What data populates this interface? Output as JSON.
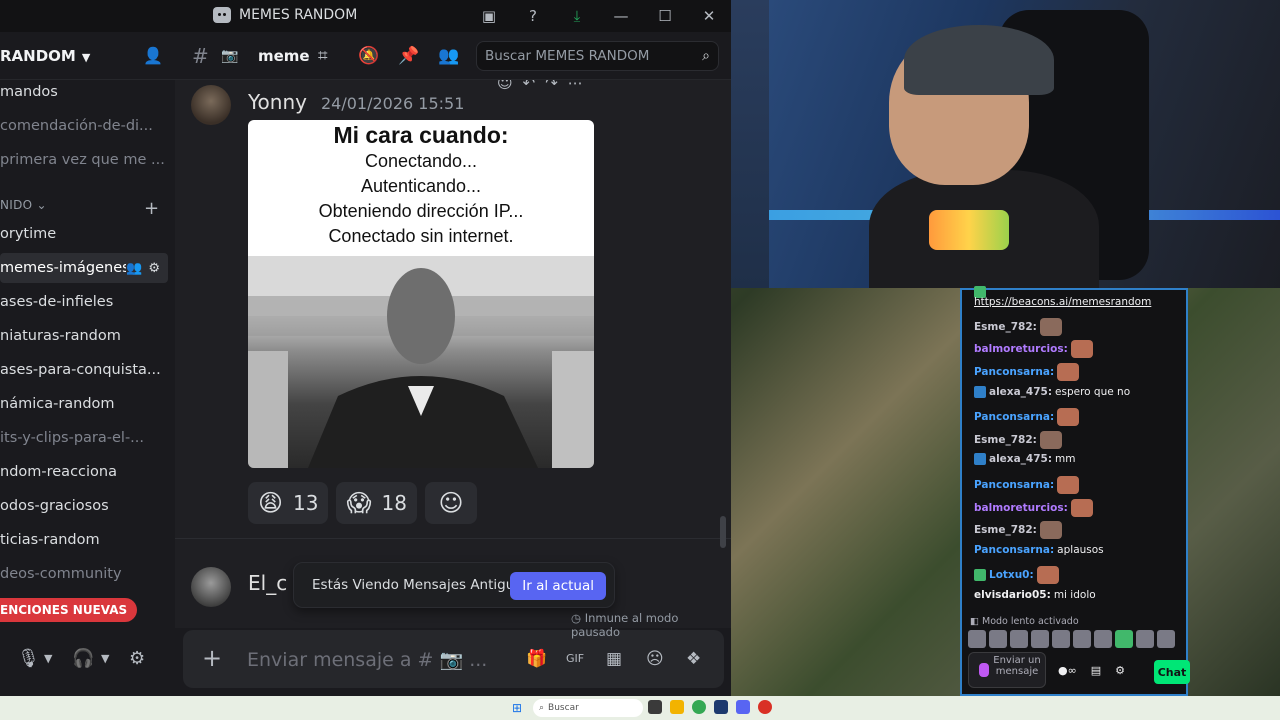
{
  "window": {
    "title": "MEMES RANDOM",
    "controls": [
      "minimize",
      "maximize",
      "close"
    ]
  },
  "sidebar": {
    "server_name": "RANDOM",
    "channels": [
      {
        "label": "mandos",
        "muted": false
      },
      {
        "label": "comendación-de-di...",
        "muted": true
      },
      {
        "label": "primera vez que me ...",
        "muted": true
      }
    ],
    "category": "NIDO",
    "category_channels": [
      {
        "label": "orytime",
        "muted": false
      },
      {
        "label": "memes-imágenes",
        "muted": false,
        "active": true
      },
      {
        "label": "ases-de-infieles",
        "muted": false
      },
      {
        "label": "niaturas-random",
        "muted": false
      },
      {
        "label": "ases-para-conquista...",
        "muted": false
      },
      {
        "label": "námica-random",
        "muted": false
      },
      {
        "label": "its-y-clips-para-el-...",
        "muted": true
      },
      {
        "label": "ndom-reacciona",
        "muted": false
      },
      {
        "label": "odos-graciosos",
        "muted": false
      },
      {
        "label": "ticias-random",
        "muted": false
      },
      {
        "label": "deos-community",
        "muted": true
      }
    ],
    "new_mentions": "ENCIONES NUEVAS"
  },
  "header": {
    "channel_name": "meme",
    "search_placeholder": "Buscar MEMES RANDOM"
  },
  "message": {
    "author": "Yonny",
    "timestamp": "24/01/2026 15:51",
    "meme": {
      "title": "Mi cara cuando:",
      "lines": [
        "Conectando...",
        "Autenticando...",
        "Obteniendo dirección IP...",
        "Conectado sin internet."
      ]
    },
    "reactions": [
      {
        "emoji": "😩",
        "count": "13"
      },
      {
        "emoji": "😱",
        "count": "18"
      }
    ]
  },
  "next_message": {
    "author": "El_c"
  },
  "old_banner": {
    "text": "Estás Viendo Mensajes Antiguos",
    "button": "Ir al actual"
  },
  "paused_text": "Inmune al modo pausado",
  "composer": {
    "placeholder": "Enviar mensaje a # 📷 ..."
  },
  "stream_chat": {
    "link": "https://beacons.ai/memesrandom",
    "lines": [
      {
        "nick": "Esme_782:",
        "color": "#c9c9d3",
        "text": "",
        "emote": true
      },
      {
        "nick": "balmoreturcios:",
        "color": "#b07bff",
        "text": "",
        "emote": true
      },
      {
        "nick": "Panconsarna:",
        "color": "#4aa3ff",
        "text": "",
        "emote": true
      },
      {
        "nick": "alexa_475:",
        "color": "#c9c9d3",
        "text": "espero que no",
        "emote": false,
        "badge": true
      },
      {
        "nick": "Panconsarna:",
        "color": "#4aa3ff",
        "text": "",
        "emote": true
      },
      {
        "nick": "Esme_782:",
        "color": "#c9c9d3",
        "text": "",
        "emote": true
      },
      {
        "nick": "alexa_475:",
        "color": "#c9c9d3",
        "text": "mm",
        "emote": false,
        "badge": true
      },
      {
        "nick": "Panconsarna:",
        "color": "#4aa3ff",
        "text": "",
        "emote": true
      },
      {
        "nick": "balmoreturcios:",
        "color": "#b07bff",
        "text": "",
        "emote": true
      },
      {
        "nick": "Esme_782:",
        "color": "#c9c9d3",
        "text": "",
        "emote": true
      },
      {
        "nick": "Panconsarna:",
        "color": "#4aa3ff",
        "text": "aplausos",
        "emote": false
      },
      {
        "nick": "Lotxu0:",
        "color": "#4aa3ff",
        "text": "",
        "emote": true,
        "badge": true
      },
      {
        "nick": "elvisdario05:",
        "color": "#efeff1",
        "text": "mi idolo",
        "emote": false
      }
    ],
    "slow_mode": "Modo lento activado",
    "input_placeholder": "Enviar un mensaje",
    "chat_button": "Chat"
  },
  "taskbar": {
    "search_label": "Buscar"
  }
}
